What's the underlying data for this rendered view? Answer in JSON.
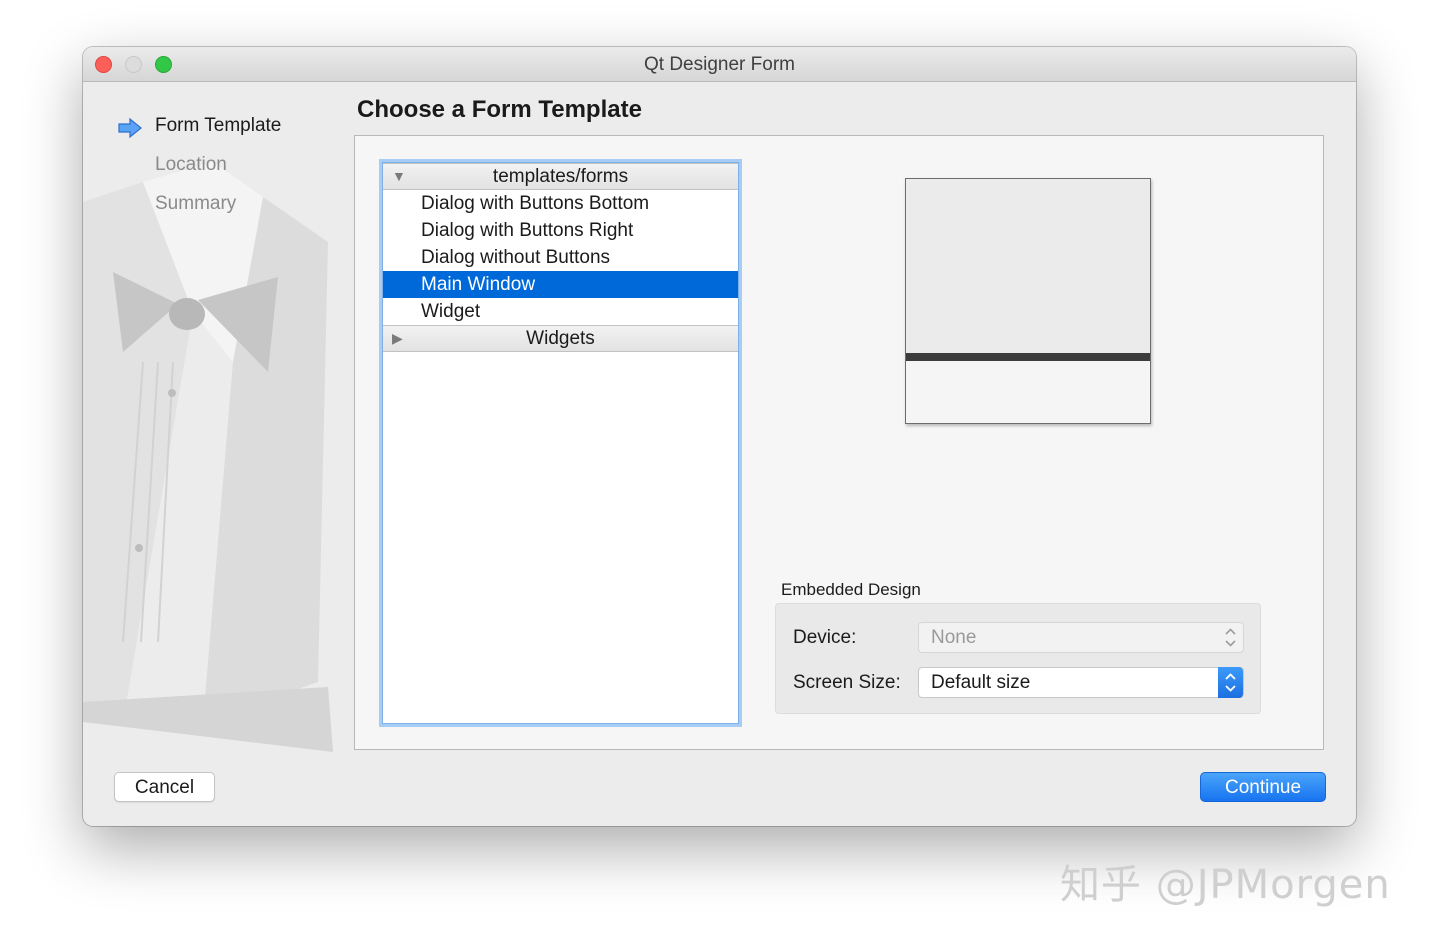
{
  "window": {
    "title": "Qt Designer Form"
  },
  "wizard": {
    "steps": [
      {
        "label": "Form Template",
        "active": true
      },
      {
        "label": "Location",
        "active": false
      },
      {
        "label": "Summary",
        "active": false
      }
    ]
  },
  "main": {
    "heading": "Choose a Form Template",
    "tree": {
      "groups": [
        {
          "label": "templates/forms",
          "expanded": true,
          "items": [
            "Dialog with Buttons Bottom",
            "Dialog with Buttons Right",
            "Dialog without Buttons",
            "Main Window",
            "Widget"
          ]
        },
        {
          "label": "Widgets",
          "expanded": false
        }
      ],
      "selected_item": "Main Window"
    },
    "embedded_design": {
      "label": "Embedded Design",
      "device_label": "Device:",
      "device_value": "None",
      "screen_size_label": "Screen Size:",
      "screen_size_value": "Default size"
    }
  },
  "buttons": {
    "cancel": "Cancel",
    "continue": "Continue"
  },
  "watermark": "知乎 @JPMorgen",
  "colors": {
    "selection": "#0069d9",
    "accent": "#1774ef",
    "focus_ring": "#a8cdf5"
  },
  "icons": {
    "current_step": "blue-arrow-icon",
    "expanded_group": "triangle-down-icon",
    "collapsed_group": "triangle-right-icon",
    "combo": "up-down-chevron-icon"
  }
}
